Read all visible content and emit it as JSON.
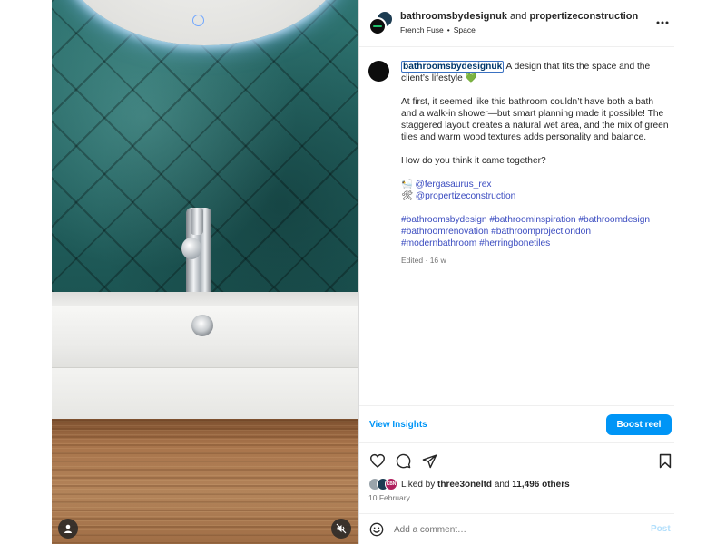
{
  "post": {
    "author": "bathroomsbydesignuk",
    "and_text": "and",
    "collaborator": "propertizeconstruction",
    "audio": "French Fuse",
    "separator": "•",
    "location": "Space"
  },
  "caption": {
    "username": "bathroomsbydesignuk",
    "headline": "A design that fits the space and the client’s lifestyle 💚",
    "paragraph": "At first, it seemed like this bathroom couldn’t have both a bath and a walk-in shower—but smart planning made it possible! The staggered layout creates a natural wet area, and the mix of green tiles and warm wood textures adds personality and balance.",
    "question": "How do you think it came together?",
    "credits": [
      {
        "emoji": "🛀",
        "handle": "@fergasaurus_rex"
      },
      {
        "emoji": "🛠",
        "handle": "@propertizeconstruction"
      }
    ],
    "hashtags": [
      "#bathroomsbydesign #bathroominspiration #bathroomdesign",
      "#bathroomrenovation #bathroomprojectlondon",
      "#modernbathroom #herringbonetiles"
    ],
    "edited": "Edited",
    "edited_sep": "·",
    "edited_age": "16 w"
  },
  "actions": {
    "view_insights": "View Insights",
    "boost": "Boost reel"
  },
  "likes": {
    "prefix": "Liked by",
    "user": "three3oneltd",
    "middle": "and",
    "count": "11,496 others",
    "avatar_badge": "KBN"
  },
  "date": "10 February",
  "comment": {
    "placeholder": "Add a comment…",
    "post": "Post"
  },
  "icons": {
    "more": "more-horizontal-icon",
    "like": "heart-icon",
    "comment": "speech-bubble-icon",
    "share": "paper-plane-icon",
    "save": "bookmark-icon",
    "emoji": "smiley-icon",
    "tag": "user-tag-icon",
    "mute": "speaker-muted-icon"
  },
  "colors": {
    "link_blue": "#0095f6",
    "hashtag": "#3b4cc0",
    "muted": "#737373",
    "tiles": "#2a6563"
  }
}
